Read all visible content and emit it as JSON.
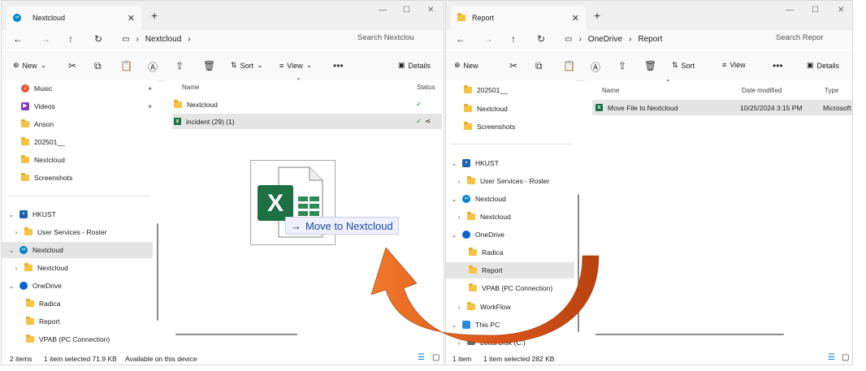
{
  "colors": {
    "accent": "#0078d4",
    "arrow": "#e35d1c",
    "excel": "#1d7044"
  },
  "left_window": {
    "tab_title": "Nextcloud",
    "breadcrumb": [
      "Nextcloud"
    ],
    "search_placeholder": "Search Nextclou",
    "toolbar": {
      "new": "New",
      "sort": "Sort",
      "view": "View",
      "details": "Details"
    },
    "nav": {
      "quick_access": [
        {
          "label": "Music",
          "icon": "music-icon"
        },
        {
          "label": "Videos",
          "icon": "videos-icon"
        },
        {
          "label": "Anson",
          "icon": "folder-icon"
        },
        {
          "label": "202501__",
          "icon": "folder-icon"
        },
        {
          "label": "Nextcloud",
          "icon": "folder-icon"
        },
        {
          "label": "Screenshots",
          "icon": "folder-icon"
        }
      ],
      "tree": [
        {
          "label": "HKUST",
          "icon": "hkust-icon"
        },
        {
          "label": "User Services - Roster",
          "icon": "folder-icon"
        },
        {
          "label": "Nextcloud",
          "icon": "nextcloud-icon"
        },
        {
          "label": "Nextcloud",
          "icon": "folder-icon"
        },
        {
          "label": "OneDrive",
          "icon": "onedrive-icon"
        },
        {
          "label": "Radica",
          "icon": "folder-icon"
        },
        {
          "label": "Report",
          "icon": "folder-icon"
        },
        {
          "label": "VPAB (PC Connection)",
          "icon": "folder-icon"
        }
      ]
    },
    "columns": {
      "name": "Name",
      "status": "Status"
    },
    "files": [
      {
        "name": "Nextcloud",
        "type": "folder",
        "status": "✓"
      },
      {
        "name": "incident (29) (1)",
        "type": "excel",
        "status": "✓"
      }
    ],
    "status": {
      "items": "2 items",
      "selected": "1 item selected  71.9 KB",
      "availability": "Available on this device"
    }
  },
  "drag": {
    "tooltip": "Move to Nextcloud",
    "arrow_glyph": "→"
  },
  "right_window": {
    "tab_title": "Report",
    "breadcrumb": [
      "OneDrive",
      "Report"
    ],
    "search_placeholder": "Search Repor",
    "toolbar": {
      "new": "New",
      "sort": "Sort",
      "view": "View",
      "details": "Details"
    },
    "nav": {
      "quick_access": [
        {
          "label": "202501__",
          "icon": "folder-icon"
        },
        {
          "label": "Nextcloud",
          "icon": "folder-icon"
        },
        {
          "label": "Screenshots",
          "icon": "folder-icon"
        }
      ],
      "tree": [
        {
          "label": "HKUST",
          "icon": "hkust-icon"
        },
        {
          "label": "User Services - Roster",
          "icon": "folder-icon"
        },
        {
          "label": "Nextcloud",
          "icon": "nextcloud-icon"
        },
        {
          "label": "Nextcloud",
          "icon": "folder-icon"
        },
        {
          "label": "OneDrive",
          "icon": "onedrive-icon"
        },
        {
          "label": "Radica",
          "icon": "folder-icon"
        },
        {
          "label": "Report",
          "icon": "folder-icon"
        },
        {
          "label": "VPAB (PC Connection)",
          "icon": "folder-icon"
        },
        {
          "label": "WorkFlow",
          "icon": "folder-icon"
        },
        {
          "label": "This PC",
          "icon": "pc-icon"
        },
        {
          "label": "Local Disk (C:)",
          "icon": "disk-icon"
        }
      ]
    },
    "columns": {
      "name": "Name",
      "date": "Date modified",
      "type": "Type"
    },
    "files": [
      {
        "name": "Move File to Nextcloud",
        "date": "10/25/2024 3:15 PM",
        "type": "Microsoft"
      }
    ],
    "status": {
      "items": "1 item",
      "selected": "1 item selected  282 KB"
    }
  }
}
